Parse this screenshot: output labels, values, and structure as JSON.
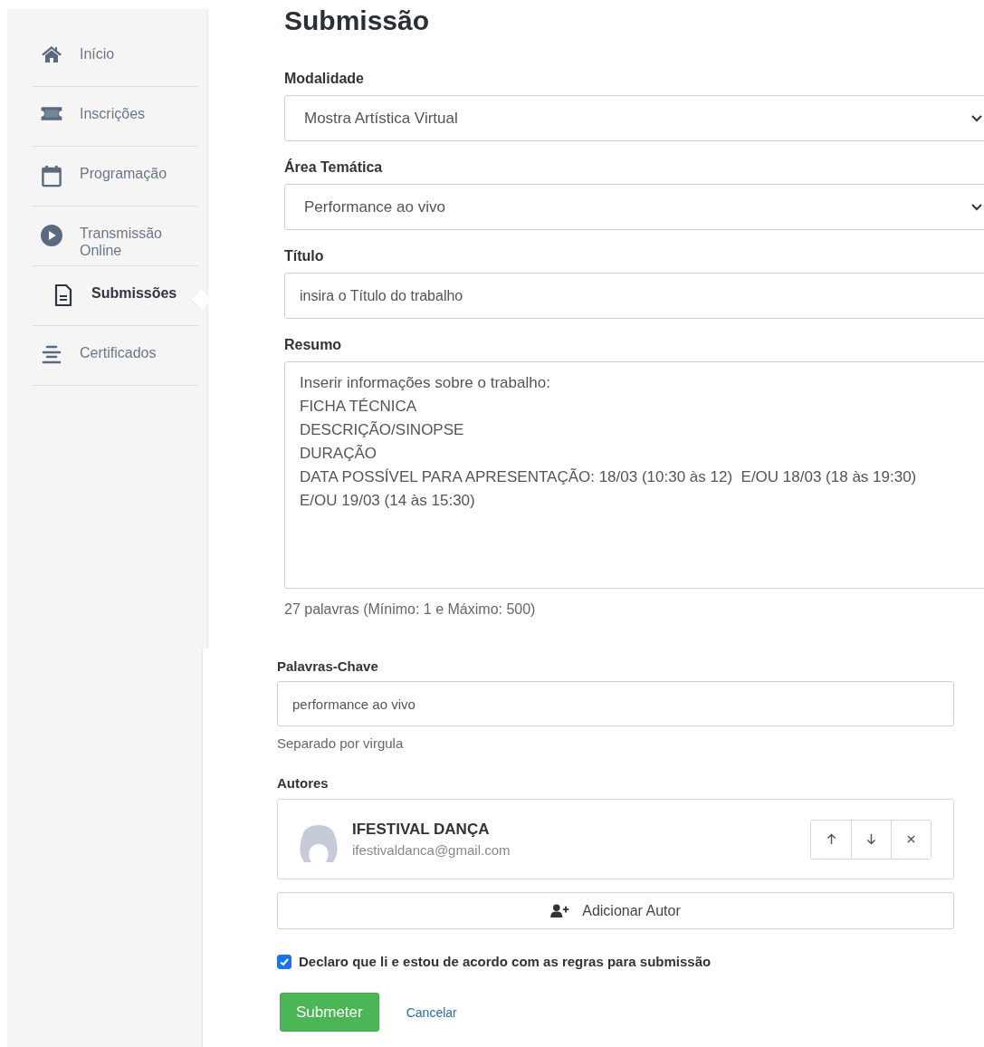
{
  "sidebar": {
    "items": [
      {
        "label": "Início",
        "kind": "home",
        "selected": false
      },
      {
        "label": "Inscrições",
        "kind": "ticket",
        "selected": false
      },
      {
        "label": "Programação",
        "kind": "calendar",
        "selected": false
      },
      {
        "label": "Transmissão Online",
        "kind": "play",
        "selected": false
      },
      {
        "label": "Submissões",
        "kind": "document",
        "selected": true
      },
      {
        "label": "Certificados",
        "kind": "list",
        "selected": false
      }
    ]
  },
  "page_title": "Submissão",
  "fields": [
    {
      "kind": "select",
      "label": "Modalidade",
      "value": "Mostra Artística Virtual"
    },
    {
      "kind": "select",
      "label": "Área Temática",
      "value": "Performance ao vivo"
    },
    {
      "kind": "input",
      "label": "Título",
      "value": "insira o Título do trabalho"
    },
    {
      "kind": "textarea",
      "label": "Resumo",
      "value": "Inserir informações sobre o trabalho:\nFICHA TÉCNICA\nDESCRIÇÃO/SINOPSE\nDURAÇÃO\nDATA POSSÍVEL PARA APRESENTAÇÃO: 18/03 (10:30 às 12)  E/OU 18/03 (18 às 19:30)\nE/OU 19/03 (14 às 15:30)",
      "help": "27 palavras (Mínimo: 1 e Máximo: 500)"
    }
  ],
  "keywords": {
    "label": "Palavras-Chave",
    "value": "performance ao vivo",
    "help": "Separado por virgula"
  },
  "authors": {
    "label": "Autores",
    "items": [
      {
        "name": "IFESTIVAL DANÇA",
        "email": "ifestivaldanca@gmail.com"
      }
    ],
    "add_button": "Adicionar Autor"
  },
  "agreement": {
    "label": "Declaro que li e estou de acordo com as regras para submissão",
    "checked": true
  },
  "buttons": {
    "submit": "Submeter",
    "cancel": "Cancelar"
  }
}
